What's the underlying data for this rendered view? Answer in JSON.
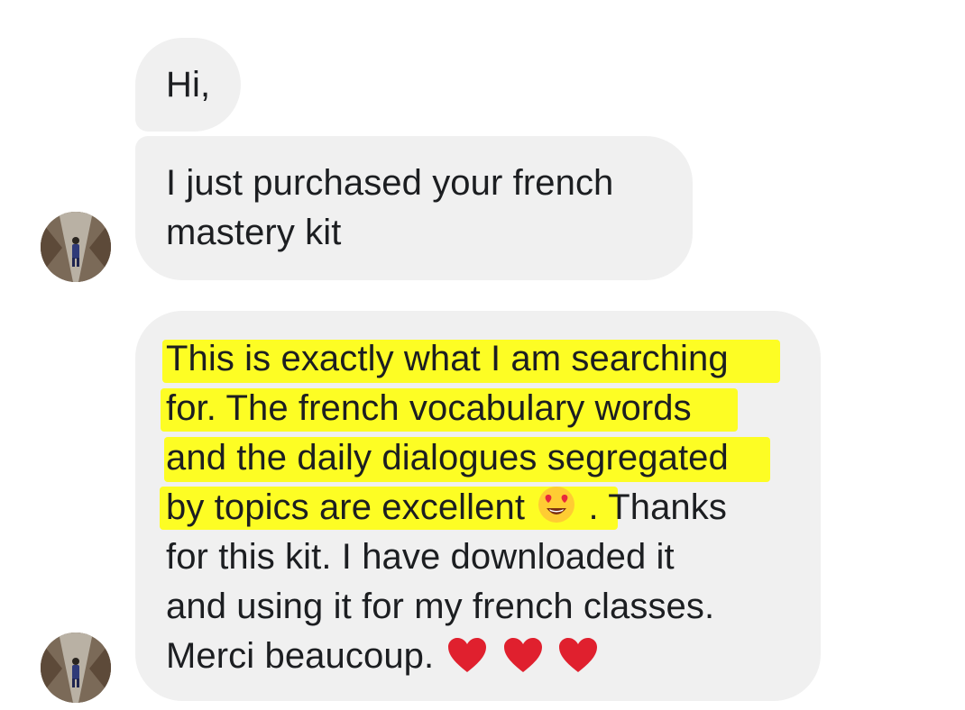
{
  "messages": [
    {
      "lines": [
        "Hi,"
      ]
    },
    {
      "lines": [
        "I just purchased your french",
        "mastery kit"
      ]
    },
    {
      "lines": [
        "This is exactly what I am searching",
        "for. The french vocabulary words",
        "and the daily dialogues segregated",
        "by topics are excellent",
        ". Thanks",
        "for this kit. I have downloaded it",
        "and using it for my french classes.",
        "Merci beaucoup."
      ],
      "emoji_after_line_4": "heart-eyes-emoji",
      "trailing_emojis": [
        "red-heart-emoji",
        "red-heart-emoji",
        "red-heart-emoji"
      ]
    }
  ],
  "highlight_color": "#ffff00",
  "bubble_color": "#f0f0f0",
  "avatar": {
    "icon": "user-avatar-photo"
  }
}
